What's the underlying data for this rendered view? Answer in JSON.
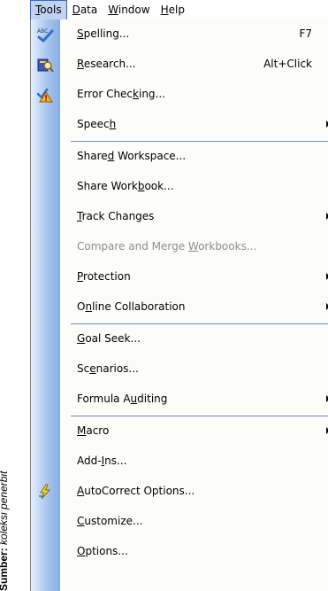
{
  "credit": {
    "label": "Sumber:",
    "source": "koleksi penerbit"
  },
  "menubar": {
    "tools": {
      "pre": "",
      "key": "T",
      "post": "ools"
    },
    "data": {
      "pre": "",
      "key": "D",
      "post": "ata"
    },
    "window": {
      "pre": "",
      "key": "W",
      "post": "indow"
    },
    "help": {
      "pre": "",
      "key": "H",
      "post": "elp"
    }
  },
  "menu": {
    "spelling": {
      "pre": "",
      "key": "S",
      "post": "pelling...",
      "shortcut": "F7",
      "icon": "spelling-abc-icon"
    },
    "research": {
      "pre": "",
      "key": "R",
      "post": "esearch...",
      "shortcut": "Alt+Click",
      "icon": "research-book-icon"
    },
    "error_checking": {
      "pre": "Error Chec",
      "key": "k",
      "post": "ing...",
      "icon": "error-checking-icon"
    },
    "speech": {
      "pre": "Speec",
      "key": "h",
      "post": ""
    },
    "shared_workspace": {
      "pre": "Share",
      "key": "d",
      "post": " Workspace..."
    },
    "share_workbook": {
      "pre": "Share Work",
      "key": "b",
      "post": "ook..."
    },
    "track_changes": {
      "pre": "",
      "key": "T",
      "post": "rack Changes"
    },
    "compare_merge": {
      "pre": "Compare and Merge ",
      "key": "W",
      "post": "orkbooks..."
    },
    "protection": {
      "pre": "",
      "key": "P",
      "post": "rotection"
    },
    "online_collab": {
      "pre": "O",
      "key": "n",
      "post": "line Collaboration"
    },
    "goal_seek": {
      "pre": "",
      "key": "G",
      "post": "oal Seek..."
    },
    "scenarios": {
      "pre": "Sc",
      "key": "e",
      "post": "narios..."
    },
    "formula_auditing": {
      "pre": "Formula A",
      "key": "u",
      "post": "diting"
    },
    "macro": {
      "pre": "",
      "key": "M",
      "post": "acro"
    },
    "addins": {
      "pre": "Add-",
      "key": "I",
      "post": "ns..."
    },
    "autocorrect": {
      "pre": "",
      "key": "A",
      "post": "utoCorrect Options...",
      "icon": "autocorrect-lightning-icon"
    },
    "customize": {
      "pre": "",
      "key": "C",
      "post": "ustomize..."
    },
    "options": {
      "pre": "",
      "key": "O",
      "post": "ptions..."
    }
  },
  "colors": {
    "gutter": "#a9c5ee",
    "separator": "#6b8ec3",
    "menu_bg": "#fcfcf9",
    "active_menubar": "#c1d2ee",
    "disabled_text": "#8d8d8d"
  }
}
